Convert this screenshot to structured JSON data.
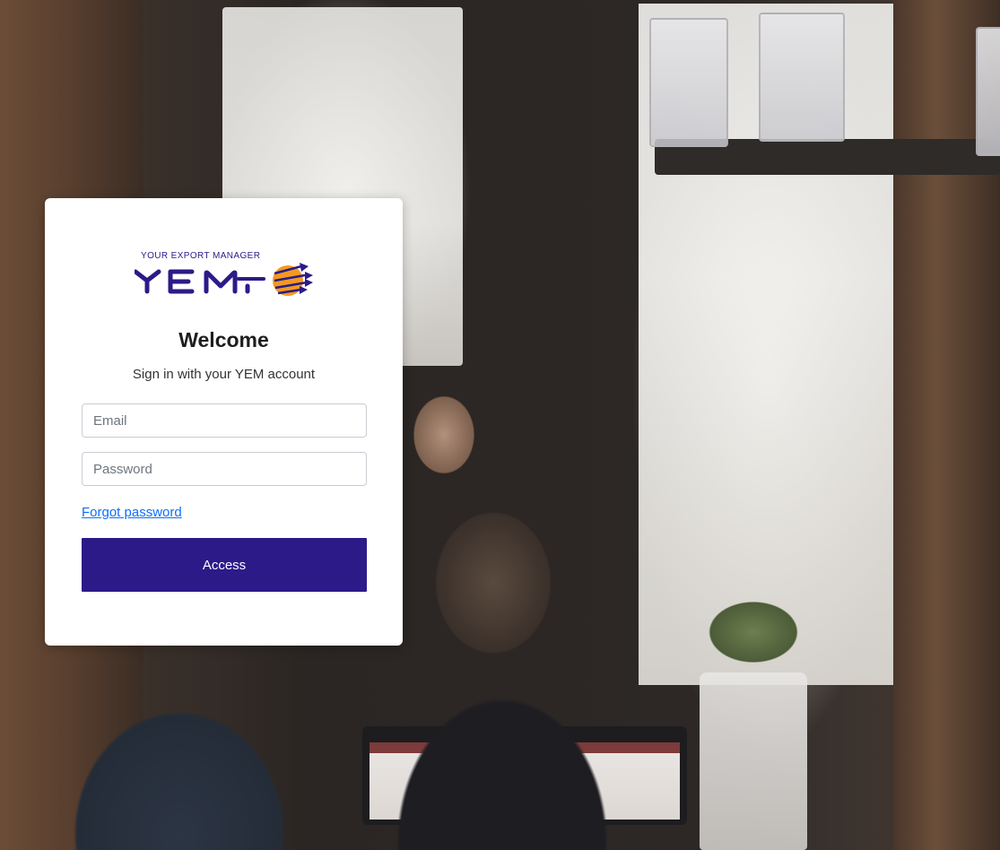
{
  "logo": {
    "tagline": "YOUR EXPORT MANAGER",
    "wordmark": "YEM",
    "icon": "globe-arrows-icon",
    "colors": {
      "primary": "#2c1a89",
      "accent": "#f29a1f"
    }
  },
  "login": {
    "title": "Welcome",
    "subtitle": "Sign in with your YEM account",
    "email_placeholder": "Email",
    "password_placeholder": "Password",
    "forgot_password_label": "Forgot password",
    "submit_label": "Access"
  },
  "theme": {
    "button_color": "#2c1a89",
    "link_color": "#0d6efd",
    "card_background": "#ffffff"
  }
}
